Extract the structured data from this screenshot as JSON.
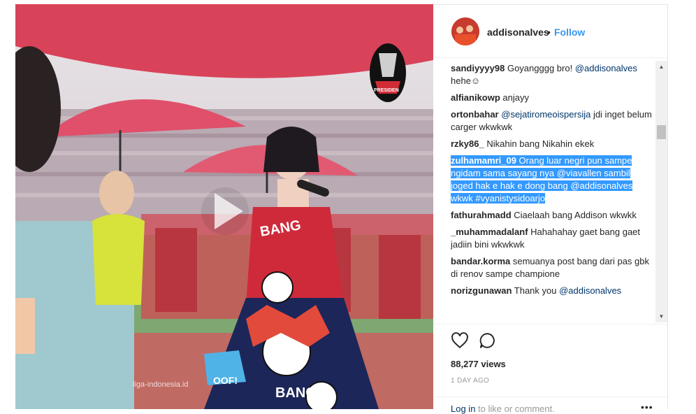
{
  "post": {
    "username": "addisonalves",
    "separator": "•",
    "follow_label": "Follow",
    "views": "88,277 views",
    "timestamp": "1 DAY AGO",
    "login_link": "Log in",
    "login_text": " to like or comment.",
    "more_label": "•••"
  },
  "media": {
    "watermark": "liga-indonesia.id",
    "dress_text_1": "BANG",
    "dress_text_2": "OOF!",
    "dress_text_3": "BANG",
    "logo_text": "PRESIDEN"
  },
  "comments": [
    {
      "user": "sandiyyyy98",
      "parts": [
        {
          "t": " Goyangggg bro! "
        },
        {
          "t": "@addisonalves",
          "m": true
        },
        {
          "t": " hehe☺"
        }
      ]
    },
    {
      "user": "alfianikowp",
      "parts": [
        {
          "t": " anjayy"
        }
      ]
    },
    {
      "user": "ortonbahar",
      "parts": [
        {
          "t": " "
        },
        {
          "t": "@sejatiromeoispersija",
          "m": true
        },
        {
          "t": " jdi inget belum carger wkwkwk"
        }
      ]
    },
    {
      "user": "rzky86_",
      "parts": [
        {
          "t": " Nikahin bang Nikahin ekek"
        }
      ]
    },
    {
      "user": "zulhamamri_09",
      "hl": true,
      "parts": [
        {
          "t": " Orang luar negri pun sampe ngidam sama sayang nya "
        },
        {
          "t": "@viavallen",
          "m": true
        },
        {
          "t": " sambil joged hak e hak e dong bang "
        },
        {
          "t": "@addisonalves",
          "m": true
        },
        {
          "t": " wkwk "
        },
        {
          "t": "#vyanistysidoarjo",
          "m": true
        }
      ]
    },
    {
      "user": "fathurahmadd",
      "parts": [
        {
          "t": " Ciaelaah bang Addison wkwkk"
        }
      ]
    },
    {
      "user": "_muhammadalanf",
      "parts": [
        {
          "t": " Hahahahay gaet bang gaet jadiin bini wkwkwk"
        }
      ]
    },
    {
      "user": "bandar.korma",
      "parts": [
        {
          "t": " semuanya post bang dari pas gbk di renov sampe champione"
        }
      ]
    },
    {
      "user": "norizgunawan",
      "parts": [
        {
          "t": " Thank you "
        },
        {
          "t": "@addisonalves",
          "m": true
        }
      ]
    }
  ],
  "icons": {
    "heart": "heart-icon",
    "comment": "comment-icon",
    "play": "play-icon"
  },
  "colors": {
    "link": "#003569",
    "follow": "#3897f0",
    "highlight": "#3399ff",
    "umbrella": "#d8435a"
  }
}
